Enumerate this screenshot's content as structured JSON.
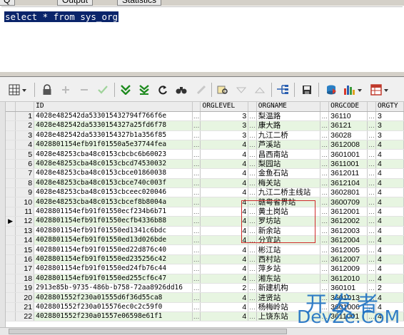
{
  "tabs": [
    "Q",
    "Output",
    "Statistics"
  ],
  "editor": {
    "sql": "select * from sys_org"
  },
  "toolbar": {
    "icons": [
      "grid-menu-icon",
      "lock-icon",
      "add-row-icon",
      "delete-row-icon",
      "post-icon",
      "next-page-icon",
      "last-page-icon",
      "refresh-icon",
      "find-icon",
      "clear-icon",
      "query-by-example-icon",
      "sort-asc-icon",
      "sort-desc-icon",
      "tree-icon",
      "save-icon",
      "export-icon",
      "chart-icon",
      "table-menu-icon"
    ]
  },
  "grid": {
    "columns": [
      "ID",
      "ORGLEVEL",
      "ORGNAME",
      "ORGCODE",
      "ORGTY"
    ],
    "current_row": 12,
    "rows": [
      {
        "n": "1",
        "id": "4028e482542da533015432794f766f6e",
        "level": "3",
        "name": "梨温路",
        "code": "36110",
        "ty": "3"
      },
      {
        "n": "2",
        "id": "4028e482542da5330154327a25fd6f78",
        "level": "3",
        "name": "康大路",
        "code": "36121",
        "ty": "3"
      },
      {
        "n": "3",
        "id": "4028e482542da5330154327b1a356f85",
        "level": "3",
        "name": "九江二桥",
        "code": "36028",
        "ty": "3"
      },
      {
        "n": "4",
        "id": "4028801154efb91f01550a5e37744fea",
        "level": "4",
        "name": "芦溪站",
        "code": "3612008",
        "ty": "4"
      },
      {
        "n": "5",
        "id": "4028e48253cba48c0153cbcbc6b60023",
        "level": "4",
        "name": "昌西南站",
        "code": "3601001",
        "ty": "4"
      },
      {
        "n": "6",
        "id": "4028e48253cba48c0153cbcd74530032",
        "level": "4",
        "name": "梨园站",
        "code": "3611001",
        "ty": "4"
      },
      {
        "n": "7",
        "id": "4028e48253cba48c0153cbce01860038",
        "level": "4",
        "name": "金鱼石站",
        "code": "3612011",
        "ty": "4"
      },
      {
        "n": "8",
        "id": "4028e48253cba48c0153cbce740c003f",
        "level": "4",
        "name": "梅关站",
        "code": "3612104",
        "ty": "4"
      },
      {
        "n": "9",
        "id": "4028e48253cba48c0153cbceec020046",
        "level": "4",
        "name": "九江二桥主线站",
        "code": "3602801",
        "ty": "4"
      },
      {
        "n": "10",
        "id": "4028e48253cba48c0153cbcef8b8004a",
        "level": "4",
        "name": "赣粤省界站",
        "code": "3600709",
        "ty": "4"
      },
      {
        "n": "11",
        "id": "4028801154efb91f01550ecf234b6b71",
        "level": "4",
        "name": "黄土岗站",
        "code": "3612001",
        "ty": "4"
      },
      {
        "n": "12",
        "id": "4028801154efb91f01550ecfb4336b88",
        "level": "4",
        "name": "罗坊站",
        "code": "3612002",
        "ty": "4"
      },
      {
        "n": "13",
        "id": "4028801154efb91f01550ed1341c6bdc",
        "level": "4",
        "name": "新余站",
        "code": "3612003",
        "ty": "4"
      },
      {
        "n": "14",
        "id": "4028801154efb91f01550ed13d026bde",
        "level": "4",
        "name": "分宜站",
        "code": "3612004",
        "ty": "4"
      },
      {
        "n": "15",
        "id": "4028801154efb91f01550ed22d876c40",
        "level": "4",
        "name": "彬江站",
        "code": "3612005",
        "ty": "4"
      },
      {
        "n": "16",
        "id": "4028801154efb91f01550ed235256c42",
        "level": "4",
        "name": "西村站",
        "code": "3612007",
        "ty": "4"
      },
      {
        "n": "17",
        "id": "4028801154efb91f01550ed24fb76c44",
        "level": "4",
        "name": "萍乡站",
        "code": "3612009",
        "ty": "4"
      },
      {
        "n": "18",
        "id": "4028801154efb91f01550ed255cf6c47",
        "level": "4",
        "name": "湘东站",
        "code": "3612010",
        "ty": "4"
      },
      {
        "n": "19",
        "id": "2913e85b-9735-486b-b758-72aa8926dd16",
        "level": "2",
        "name": "新建机构",
        "code": "360101",
        "ty": "2"
      },
      {
        "n": "20",
        "id": "4028801552f230a01555d6f36d55ca8",
        "level": "4",
        "name": "进贤站",
        "code": "3601013",
        "ty": "4"
      },
      {
        "n": "21",
        "id": "4028801552f230a015576ec0c2c59f0",
        "level": "4",
        "name": "杨梅岭站",
        "code": "3601006",
        "ty": "4"
      },
      {
        "n": "22",
        "id": "4028801552f230a01557e06598e61f1",
        "level": "4",
        "name": "上饶东站",
        "code": "3611001",
        "ty": "4"
      }
    ]
  },
  "watermark": {
    "line1": "开发者",
    "line2": "DevZe.CoM"
  },
  "colors": {
    "selection": "#0a246a",
    "row_alt": "#e7f5e1",
    "highlight_box": "#d02a2a",
    "watermark": "#1b6fc2"
  }
}
